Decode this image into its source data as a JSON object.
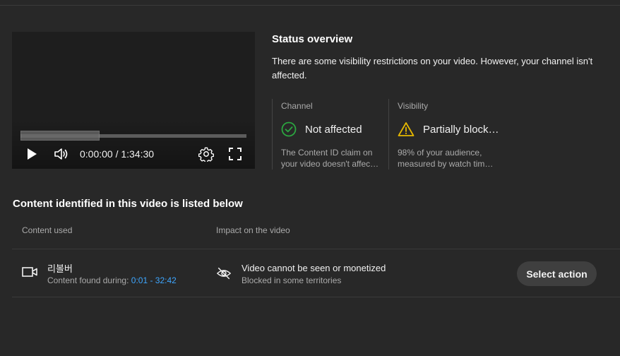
{
  "player": {
    "time": "0:00:00 / 1:34:30",
    "progress_played_fraction": 0,
    "buffered_fraction": 0.35
  },
  "status": {
    "title": "Status overview",
    "description": "There are some visibility restrictions on your video. However, your channel isn't affected.",
    "channel": {
      "label": "Channel",
      "status": "Not affected",
      "icon": "check-circle-icon",
      "color": "#2ba640",
      "desc_line1": "The Content ID claim on",
      "desc_line2": "your video doesn't affec…"
    },
    "visibility": {
      "label": "Visibility",
      "status": "Partially block…",
      "icon": "warning-icon",
      "color": "#e6b800",
      "desc_line1": "98% of your audience,",
      "desc_line2": "measured by watch tim…"
    }
  },
  "content": {
    "section_title": "Content identified in this video is listed below",
    "col_content_used": "Content used",
    "col_impact": "Impact on the video",
    "row": {
      "name": "리볼버",
      "found_label": "Content found during: ",
      "found_range": "0:01 - 32:42",
      "impact_main": "Video cannot be seen or monetized",
      "impact_sub": "Blocked in some territories",
      "action_label": "Select action"
    }
  },
  "colors": {
    "background": "#282828",
    "link": "#3ea6ff",
    "button_bg": "#3f3f3f"
  }
}
